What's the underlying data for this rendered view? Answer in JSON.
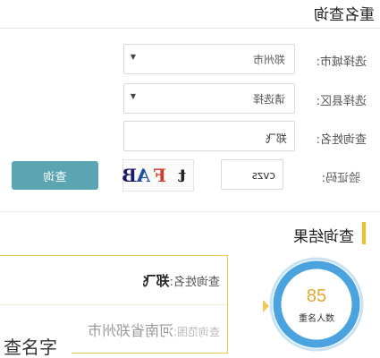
{
  "header": {
    "title": "重名查询"
  },
  "form": {
    "city": {
      "label": "选择城市:",
      "value": "郑州市"
    },
    "district": {
      "label": "选择县区:",
      "value": "请选择"
    },
    "name": {
      "label": "查询姓名:",
      "value": "郑飞"
    },
    "captcha": {
      "label": "验证码:",
      "value": "cvzs",
      "image_text": [
        "t",
        "F",
        "A",
        "B"
      ]
    },
    "submit_label": "查询"
  },
  "results": {
    "title": "查询结果",
    "name_label": "查询姓名:",
    "name_value": "郑飞",
    "scope_label": "查询范围:",
    "scope_value": "河南省郑州市",
    "count": "85",
    "count_label": "重名人数"
  },
  "caption": "查名字",
  "colors": {
    "accent": "#5ba5b3",
    "highlight": "#f0c020",
    "ring": "#4aa3df"
  }
}
